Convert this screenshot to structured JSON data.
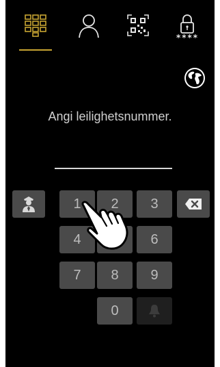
{
  "colors": {
    "accent": "#c8a532",
    "background": "#000000",
    "key": "#4a4a4a",
    "key_text": "#bdbdbd"
  },
  "tabs": [
    {
      "icon": "keypad-icon",
      "active": true
    },
    {
      "icon": "person-icon",
      "active": false
    },
    {
      "icon": "qr-code-icon",
      "active": false
    },
    {
      "icon": "lock-code-icon",
      "active": false
    }
  ],
  "lock_code_label": "****",
  "language_icon": "globe-icon",
  "prompt": "Angi leilighetsnummer.",
  "entry_value": "",
  "keypad": {
    "concierge_icon": "concierge-icon",
    "backspace_icon": "backspace-icon",
    "bell_icon": "bell-icon",
    "keys": [
      "1",
      "2",
      "3",
      "4",
      "5",
      "6",
      "7",
      "8",
      "9",
      "0"
    ]
  },
  "pointer_icon": "hand-pointer-icon"
}
